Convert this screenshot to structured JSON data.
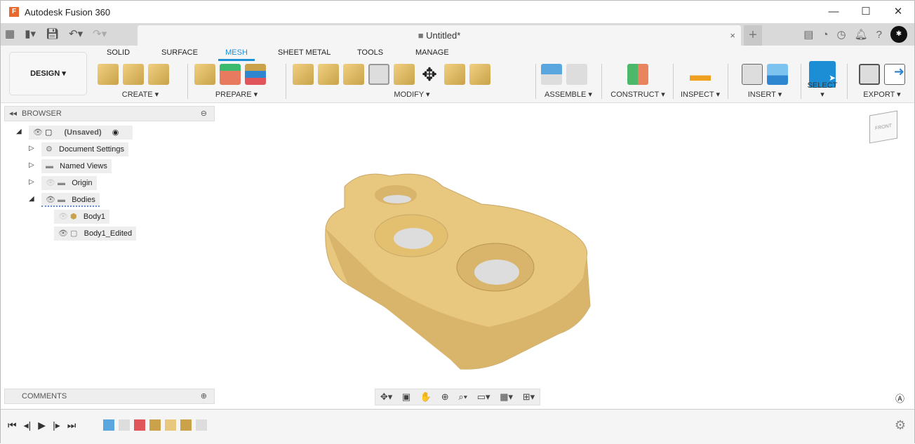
{
  "window": {
    "title": "Autodesk Fusion 360",
    "app_icon": "F",
    "minimize": "—",
    "maximize": "☐",
    "close": "✕"
  },
  "document": {
    "tab_title": "Untitled*",
    "close": "×",
    "new_tab": "+"
  },
  "workspace": {
    "label": "DESIGN ▾"
  },
  "tabs": [
    "SOLID",
    "SURFACE",
    "MESH",
    "SHEET METAL",
    "TOOLS",
    "MANAGE"
  ],
  "active_tab": "MESH",
  "groups": {
    "create": "CREATE ▾",
    "prepare": "PREPARE ▾",
    "modify": "MODIFY ▾",
    "assemble": "ASSEMBLE ▾",
    "construct": "CONSTRUCT ▾",
    "inspect": "INSPECT ▾",
    "insert": "INSERT ▾",
    "select": "SELECT ▾",
    "export": "EXPORT ▾"
  },
  "browser": {
    "title": "BROWSER",
    "root": "(Unsaved)",
    "items": [
      {
        "label": "Document Settings"
      },
      {
        "label": "Named Views"
      },
      {
        "label": "Origin"
      },
      {
        "label": "Bodies"
      },
      {
        "label": "Body1"
      },
      {
        "label": "Body1_Edited"
      }
    ]
  },
  "comments": {
    "title": "COMMENTS"
  },
  "colors": {
    "accent": "#1c8ed6",
    "mesh": "#e8c77e"
  }
}
